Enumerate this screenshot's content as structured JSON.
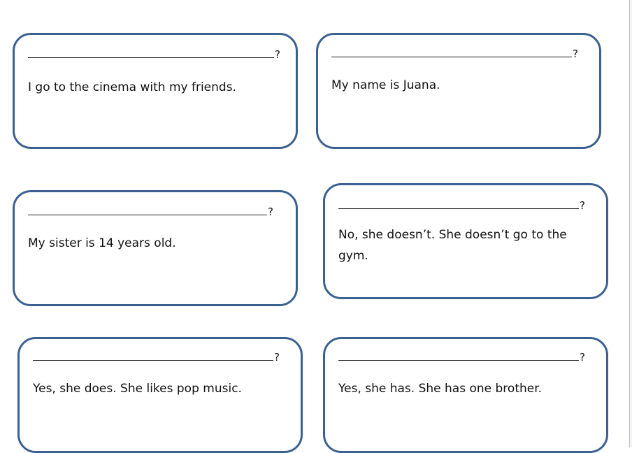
{
  "cards": [
    {
      "blank": "?",
      "answer": "I go to the cinema with my friends."
    },
    {
      "blank": "?",
      "answer": "My name is Juana."
    },
    {
      "blank": "?",
      "answer": "My sister is 14 years old."
    },
    {
      "blank": "?",
      "answer": "No, she doesn’t. She doesn’t go to the gym."
    },
    {
      "blank": "?",
      "answer": "Yes, she does. She likes pop music."
    },
    {
      "blank": "?",
      "answer": "Yes, she has. She has one brother."
    }
  ]
}
